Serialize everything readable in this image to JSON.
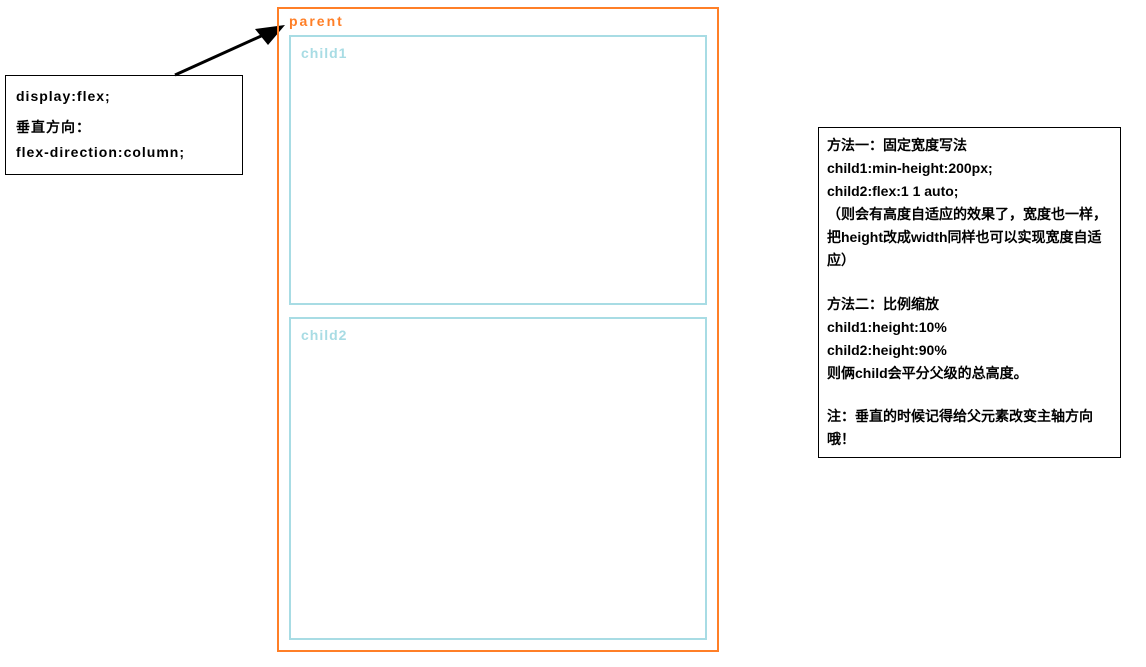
{
  "leftBox": {
    "line1": "display:flex;",
    "line2": "垂直方向：",
    "line3": "flex-direction:column;"
  },
  "parent": {
    "label": "parent",
    "child1": "child1",
    "child2": "child2"
  },
  "rightBox": {
    "method1_title": "方法一：固定宽度写法",
    "method1_line1": "child1:min-height:200px;",
    "method1_line2": "child2:flex:1 1 auto;",
    "method1_note": "（则会有高度自适应的效果了，宽度也一样，把height改成width同样也可以实现宽度自适应）",
    "method2_title": "方法二：比例缩放",
    "method2_line1": "child1:height:10%",
    "method2_line2": "child2:height:90%",
    "method2_note": "则俩child会平分父级的总高度。",
    "footnote": "注：垂直的时候记得给父元素改变主轴方向哦！"
  },
  "colors": {
    "parentBorder": "#ff7f27",
    "childBorder": "#a8dce4"
  }
}
